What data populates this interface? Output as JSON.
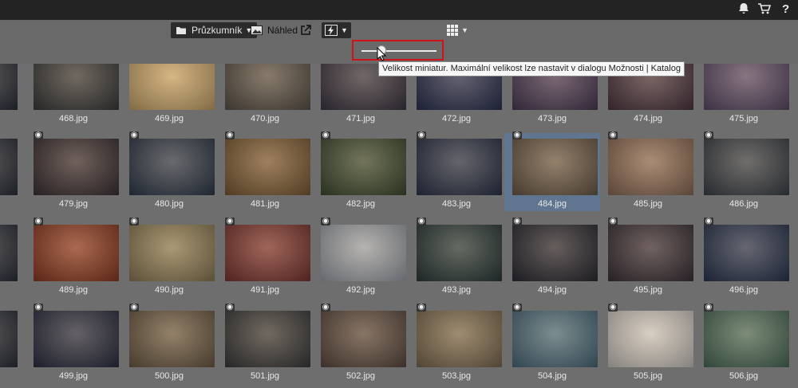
{
  "topbar": {
    "icons": [
      "bell-icon",
      "cart-icon",
      "help-icon"
    ],
    "help_glyph": "?"
  },
  "toolbar": {
    "explorer_label": "Průzkumník",
    "preview_label": "Náhled",
    "slider_value": 0.27,
    "tooltip": "Velikost miniatur. Maximální velikost lze nastavit v dialogu Možnosti | Katalog"
  },
  "grid": {
    "selected": "484.jpg",
    "rows": [
      [
        "468.jpg",
        "469.jpg",
        "470.jpg",
        "471.jpg",
        "472.jpg",
        "473.jpg",
        "474.jpg",
        "475.jpg"
      ],
      [
        "479.jpg",
        "480.jpg",
        "481.jpg",
        "482.jpg",
        "483.jpg",
        "484.jpg",
        "485.jpg",
        "486.jpg"
      ],
      [
        "489.jpg",
        "490.jpg",
        "491.jpg",
        "492.jpg",
        "493.jpg",
        "494.jpg",
        "495.jpg",
        "496.jpg"
      ],
      [
        "499.jpg",
        "500.jpg",
        "501.jpg",
        "502.jpg",
        "503.jpg",
        "504.jpg",
        "505.jpg",
        "506.jpg"
      ]
    ],
    "colors": [
      [
        "#3a3a3a",
        "#c6a46a",
        "#5a5248",
        "#3b3642",
        "#2a3150",
        "#4a3a55",
        "#4a3640",
        "#5a4a66"
      ],
      [
        "#3a2f33",
        "#2f3a4a",
        "#7a5a35",
        "#3d4a30",
        "#2a3348",
        "#6a5a48",
        "#8a6a55",
        "#3a4048"
      ],
      [
        "#8a3a22",
        "#8a7a55",
        "#7a3530",
        "#9aa0a8",
        "#2a3a3a",
        "#2a2a33",
        "#3a3038",
        "#2a3550"
      ],
      [
        "#2a2e40",
        "#6a5a45",
        "#3a3a3a",
        "#5a4a40",
        "#7a6a50",
        "#4a6a7a",
        "#cac6c0",
        "#4a6a5a"
      ]
    ]
  }
}
